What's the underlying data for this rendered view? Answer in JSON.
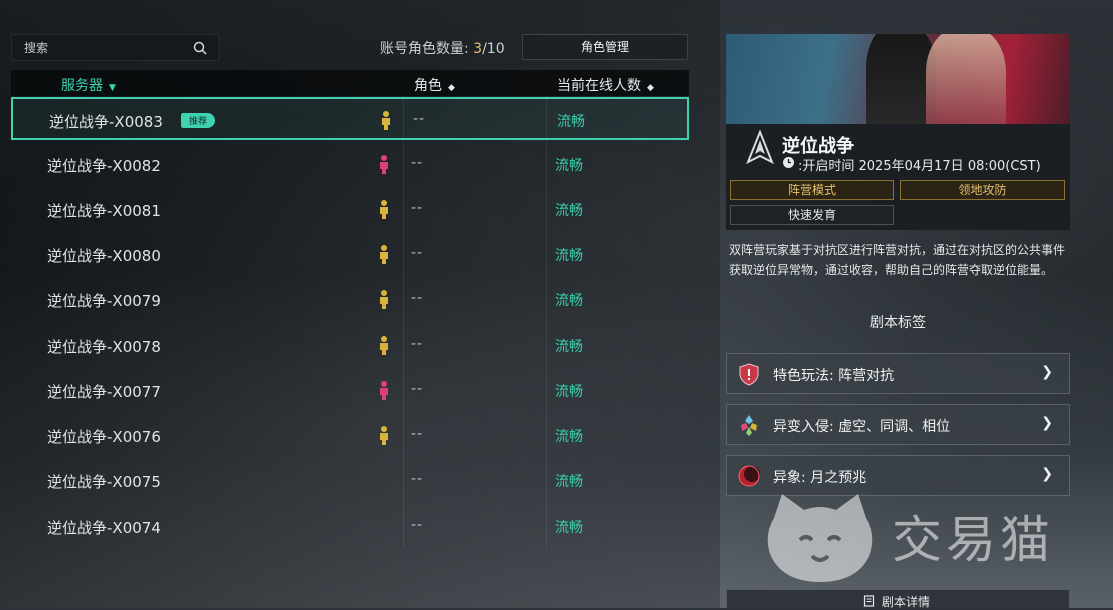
{
  "search": {
    "placeholder": "搜索"
  },
  "account": {
    "label": "账号角色数量:",
    "current": "3",
    "max": "/10",
    "manage_button": "角色管理"
  },
  "table": {
    "headers": {
      "server": "服务器",
      "role": "角色",
      "online": "当前在线人数"
    },
    "sort_icons": {
      "server": "▼",
      "role": "◆",
      "online": "◆"
    },
    "rows": [
      {
        "name": "逆位战争-X0083",
        "badge": "推荐",
        "pin": "yellow",
        "role": "--",
        "status": "流畅"
      },
      {
        "name": "逆位战争-X0082",
        "pin": "pink",
        "role": "--",
        "status": "流畅"
      },
      {
        "name": "逆位战争-X0081",
        "pin": "yellow",
        "role": "--",
        "status": "流畅"
      },
      {
        "name": "逆位战争-X0080",
        "pin": "yellow",
        "role": "--",
        "status": "流畅"
      },
      {
        "name": "逆位战争-X0079",
        "pin": "yellow",
        "role": "--",
        "status": "流畅"
      },
      {
        "name": "逆位战争-X0078",
        "pin": "yellow",
        "role": "--",
        "status": "流畅"
      },
      {
        "name": "逆位战争-X0077",
        "pin": "pink",
        "role": "--",
        "status": "流畅"
      },
      {
        "name": "逆位战争-X0076",
        "pin": "yellow",
        "role": "--",
        "status": "流畅"
      },
      {
        "name": "逆位战争-X0075",
        "role": "--",
        "status": "流畅"
      },
      {
        "name": "逆位战争-X0074",
        "role": "--",
        "status": "流畅"
      }
    ]
  },
  "scenario": {
    "title": "逆位战争",
    "open_time": ":开启时间 2025年04月17日 08:00(CST)",
    "tags": [
      "阵营模式",
      "领地攻防",
      "快速发育"
    ],
    "description": "双阵营玩家基于对抗区进行阵营对抗，通过在对抗区的公共事件获取逆位异常物，通过收容，帮助自己的阵营夺取逆位能量。",
    "section_title": "剧本标签",
    "features": [
      {
        "label": "特色玩法: 阵营对抗",
        "icon": "shield-icon"
      },
      {
        "label": "异变入侵: 虚空、同调、相位",
        "icon": "crystal-icon"
      },
      {
        "label": "异象: 月之预兆",
        "icon": "moon-omen-icon"
      }
    ],
    "detail_button": "剧本详情"
  },
  "watermark": {
    "text": "交易猫"
  },
  "colors": {
    "accent": "#3ed2b0",
    "gold": "#e4c06a",
    "pin_yellow": "#d8b43a",
    "pin_pink": "#e0407a"
  }
}
